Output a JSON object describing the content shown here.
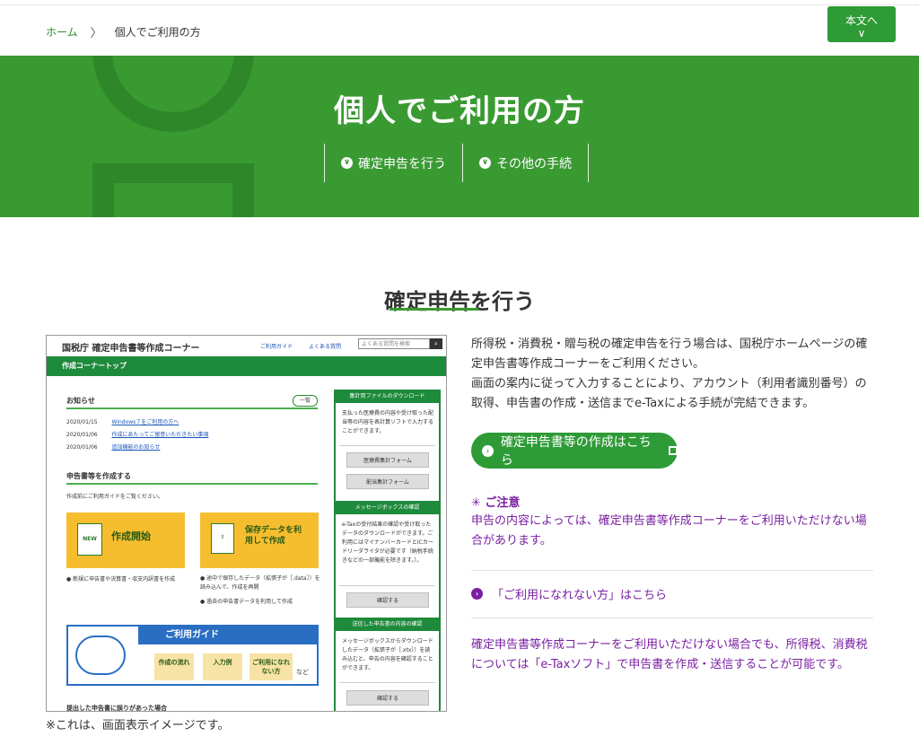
{
  "breadcrumb": {
    "home": "ホーム",
    "separator": "〉",
    "current": "個人でご利用の方"
  },
  "skip": {
    "label": "本文へ",
    "icon": "chevron-down-icon",
    "chevron": "∨"
  },
  "hero": {
    "title": "個人でご利用の方",
    "nav": [
      {
        "label": "確定申告を行う",
        "icon": "chevron-down-circle-icon"
      },
      {
        "label": "その他の手続",
        "icon": "chevron-down-circle-icon"
      }
    ]
  },
  "section": {
    "title": "確定申告を行う"
  },
  "mock": {
    "title": "国税庁 確定申告書等作成コーナー",
    "guide_link": "ご利用ガイド",
    "faq_link": "よくある質問",
    "search_placeholder": "よくある質問を検索",
    "bar": "作成コーナートップ",
    "notice_title": "お知らせ",
    "list_button": "一覧",
    "news": [
      {
        "date": "2020/01/15",
        "text": "Windows７をご利用の方へ"
      },
      {
        "date": "2020/01/06",
        "text": "作成にあたってご留意いただきたい事項"
      },
      {
        "date": "2020/01/06",
        "text": "追加機能のお知らせ"
      }
    ],
    "create_title": "申告書等を作成する",
    "create_sub": "作成前にご利用ガイドをご覧ください。",
    "card_new": "作成開始",
    "card_new_badge": "NEW",
    "card_resume": "保存データを利用して作成",
    "note_new": "● 新規に申告書や決算書・収支内訳書を作成",
    "note_resume1": "● 途中で保存したデータ（拡張子が［.data］）を読み込んで、作成を再開",
    "note_resume2": "● 過去の申告書データを利用して作成",
    "guide_banner": "ご利用ガイド",
    "guide_boxes": [
      "作成の流れ",
      "入力例",
      "ご利用になれない方"
    ],
    "guide_etc": "など",
    "bottom": "提出した申告書に誤りがあった場合",
    "side": {
      "head1": "集計用ファイルのダウンロード",
      "text1": "支払った医療費の内容や受け取った配当等の内容を表計算ソフトで入力することができます。",
      "btn1": "医療費集計フォーム",
      "btn2": "配当集計フォーム",
      "head2": "メッセージボックスの確認",
      "text2": "e-Taxの受付結果の確認や受け取ったデータのダウンロードができます。ご利用にはマイナンバーカードとICカードリーダライタが必要です（納税手続きなどの一部機能を除きます。）。",
      "btn3": "確認する",
      "head3": "送信した申告書の内容の確認",
      "text3": "メッセージボックスからダウンロードしたデータ（拡張子が［.xtx］）を読み込むと、申告の内容を確認することができます。",
      "btn4": "確認する"
    }
  },
  "caption": "※これは、画面表示イメージです。",
  "description": "所得税・消費税・贈与税の確定申告を行う場合は、国税庁ホームページの確定申告書等作成コーナーをご利用ください。\n画面の案内に従って入力することにより、アカウント（利用者識別番号）の取得、申告書の作成・送信までe-Taxによる手続が完結できます。",
  "cta": {
    "label": "確定申告書等の作成はこちら",
    "icon": "arrow-right-circle-icon",
    "external_icon": "external-window-icon"
  },
  "caution": {
    "heading": "✳ ご注意",
    "body": "申告の内容によっては、確定申告書等作成コーナーをご利用いただけない場合があります。"
  },
  "unavailable_link": "「ご利用になれない方」はこちら",
  "bottom_note": "確定申告書等作成コーナーをご利用いただけない場合でも、所得税、消費税については「e-Taxソフト」で申告書を作成・送信することが可能です。",
  "colors": {
    "brand_green": "#3a9a32",
    "caution_purple": "#7a1fa2"
  }
}
